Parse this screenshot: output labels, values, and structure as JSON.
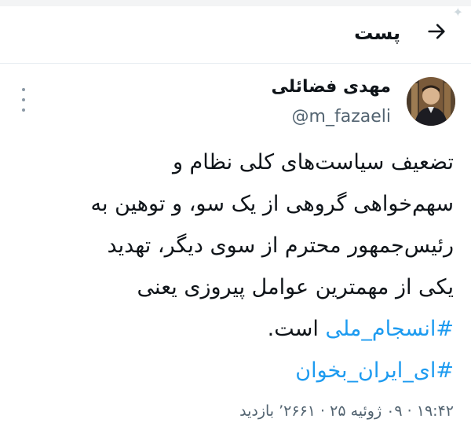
{
  "header": {
    "title": "پست",
    "back_icon": "arrow-right-icon"
  },
  "author": {
    "name": "مهدی فضائلی",
    "handle": "@m_fazaeli",
    "avatar_icon": "profile-photo"
  },
  "tweet": {
    "lines": [
      "تضعیف سیاست‌های کلی نظام و",
      "سهم‌خواهی گروهی از یک سو، و توهین به",
      "رئیس‌جمهور محترم از سوی دیگر، تهدید",
      "یکی از مهمترین عوامل پیروزی یعنی"
    ],
    "hashtag_1": "#انسجام_ملی",
    "after_hashtag_1": " است.",
    "hashtag_2": "#ای_ایران_بخوان"
  },
  "meta": {
    "time": "۱۹:۴۲",
    "date": "۰۹ ژوئیه ۲۵",
    "views_count": "۲۶۶۱’",
    "views_label": "بازدید",
    "separator": "·"
  },
  "colors": {
    "link": "#1d9bf0",
    "secondary": "#536471",
    "text": "#0f1419"
  },
  "icons": {
    "more": "more-vertical-icon",
    "sparkle": "sparkle-icon"
  }
}
